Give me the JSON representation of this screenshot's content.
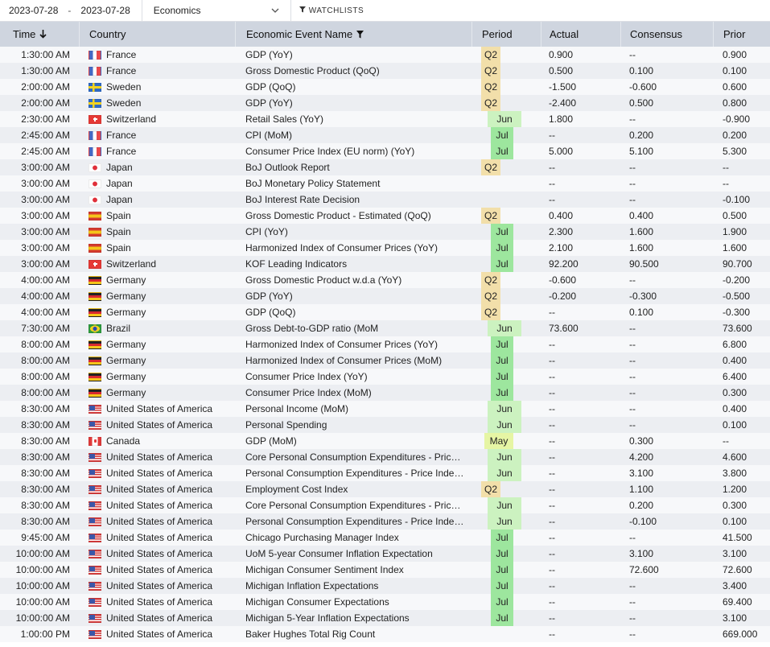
{
  "toolbar": {
    "date_from": "2023-07-28",
    "separator": "-",
    "date_to": "2023-07-28",
    "category": "Economics",
    "watchlists_label": "WATCHLISTS"
  },
  "columns": {
    "time": "Time",
    "country": "Country",
    "event": "Economic Event Name",
    "period": "Period",
    "actual": "Actual",
    "consensus": "Consensus",
    "prior": "Prior"
  },
  "rows": [
    {
      "time": "1:30:00 AM",
      "flag": "fr",
      "country": "France",
      "event": "GDP (YoY)",
      "period": "Q2",
      "actual": "0.900",
      "consensus": "--",
      "prior": "0.900"
    },
    {
      "time": "1:30:00 AM",
      "flag": "fr",
      "country": "France",
      "event": "Gross Domestic Product (QoQ)",
      "period": "Q2",
      "actual": "0.500",
      "consensus": "0.100",
      "prior": "0.100"
    },
    {
      "time": "2:00:00 AM",
      "flag": "se",
      "country": "Sweden",
      "event": "GDP (QoQ)",
      "period": "Q2",
      "actual": "-1.500",
      "consensus": "-0.600",
      "prior": "0.600"
    },
    {
      "time": "2:00:00 AM",
      "flag": "se",
      "country": "Sweden",
      "event": "GDP (YoY)",
      "period": "Q2",
      "actual": "-2.400",
      "consensus": "0.500",
      "prior": "0.800"
    },
    {
      "time": "2:30:00 AM",
      "flag": "ch",
      "country": "Switzerland",
      "event": "Retail Sales (YoY)",
      "period": "Jun",
      "actual": "1.800",
      "consensus": "--",
      "prior": "-0.900"
    },
    {
      "time": "2:45:00 AM",
      "flag": "fr",
      "country": "France",
      "event": "CPI (MoM)",
      "period": "Jul",
      "actual": "--",
      "consensus": "0.200",
      "prior": "0.200"
    },
    {
      "time": "2:45:00 AM",
      "flag": "fr",
      "country": "France",
      "event": "Consumer Price Index (EU norm) (YoY)",
      "period": "Jul",
      "actual": "5.000",
      "consensus": "5.100",
      "prior": "5.300"
    },
    {
      "time": "3:00:00 AM",
      "flag": "jp",
      "country": "Japan",
      "event": "BoJ Outlook Report",
      "period": "Q2",
      "actual": "--",
      "consensus": "--",
      "prior": "--"
    },
    {
      "time": "3:00:00 AM",
      "flag": "jp",
      "country": "Japan",
      "event": "BoJ Monetary Policy Statement",
      "period": "",
      "actual": "--",
      "consensus": "--",
      "prior": "--"
    },
    {
      "time": "3:00:00 AM",
      "flag": "jp",
      "country": "Japan",
      "event": "BoJ Interest Rate Decision",
      "period": "",
      "actual": "--",
      "consensus": "--",
      "prior": "-0.100"
    },
    {
      "time": "3:00:00 AM",
      "flag": "es",
      "country": "Spain",
      "event": "Gross Domestic Product - Estimated (QoQ)",
      "period": "Q2",
      "actual": "0.400",
      "consensus": "0.400",
      "prior": "0.500"
    },
    {
      "time": "3:00:00 AM",
      "flag": "es",
      "country": "Spain",
      "event": "CPI (YoY)",
      "period": "Jul",
      "actual": "2.300",
      "consensus": "1.600",
      "prior": "1.900"
    },
    {
      "time": "3:00:00 AM",
      "flag": "es",
      "country": "Spain",
      "event": "Harmonized Index of Consumer Prices (YoY)",
      "period": "Jul",
      "actual": "2.100",
      "consensus": "1.600",
      "prior": "1.600"
    },
    {
      "time": "3:00:00 AM",
      "flag": "ch",
      "country": "Switzerland",
      "event": "KOF Leading Indicators",
      "period": "Jul",
      "actual": "92.200",
      "consensus": "90.500",
      "prior": "90.700"
    },
    {
      "time": "4:00:00 AM",
      "flag": "de",
      "country": "Germany",
      "event": "Gross Domestic Product w.d.a (YoY)",
      "period": "Q2",
      "actual": "-0.600",
      "consensus": "--",
      "prior": "-0.200"
    },
    {
      "time": "4:00:00 AM",
      "flag": "de",
      "country": "Germany",
      "event": "GDP (YoY)",
      "period": "Q2",
      "actual": "-0.200",
      "consensus": "-0.300",
      "prior": "-0.500"
    },
    {
      "time": "4:00:00 AM",
      "flag": "de",
      "country": "Germany",
      "event": "GDP (QoQ)",
      "period": "Q2",
      "actual": "--",
      "consensus": "0.100",
      "prior": "-0.300"
    },
    {
      "time": "7:30:00 AM",
      "flag": "br",
      "country": "Brazil",
      "event": "Gross Debt-to-GDP ratio (MoM",
      "period": "Jun",
      "actual": "73.600",
      "consensus": "--",
      "prior": "73.600"
    },
    {
      "time": "8:00:00 AM",
      "flag": "de",
      "country": "Germany",
      "event": "Harmonized Index of Consumer Prices (YoY)",
      "period": "Jul",
      "actual": "--",
      "consensus": "--",
      "prior": "6.800"
    },
    {
      "time": "8:00:00 AM",
      "flag": "de",
      "country": "Germany",
      "event": "Harmonized Index of Consumer Prices (MoM)",
      "period": "Jul",
      "actual": "--",
      "consensus": "--",
      "prior": "0.400"
    },
    {
      "time": "8:00:00 AM",
      "flag": "de",
      "country": "Germany",
      "event": "Consumer Price Index (YoY)",
      "period": "Jul",
      "actual": "--",
      "consensus": "--",
      "prior": "6.400"
    },
    {
      "time": "8:00:00 AM",
      "flag": "de",
      "country": "Germany",
      "event": "Consumer Price Index (MoM)",
      "period": "Jul",
      "actual": "--",
      "consensus": "--",
      "prior": "0.300"
    },
    {
      "time": "8:30:00 AM",
      "flag": "us",
      "country": "United States of America",
      "event": "Personal Income (MoM)",
      "period": "Jun",
      "actual": "--",
      "consensus": "--",
      "prior": "0.400"
    },
    {
      "time": "8:30:00 AM",
      "flag": "us",
      "country": "United States of America",
      "event": "Personal Spending",
      "period": "Jun",
      "actual": "--",
      "consensus": "--",
      "prior": "0.100"
    },
    {
      "time": "8:30:00 AM",
      "flag": "ca",
      "country": "Canada",
      "event": "GDP (MoM)",
      "period": "May",
      "actual": "--",
      "consensus": "0.300",
      "prior": "--"
    },
    {
      "time": "8:30:00 AM",
      "flag": "us",
      "country": "United States of America",
      "event": "Core Personal Consumption Expenditures - Price Index (YoY)",
      "period": "Jun",
      "actual": "--",
      "consensus": "4.200",
      "prior": "4.600"
    },
    {
      "time": "8:30:00 AM",
      "flag": "us",
      "country": "United States of America",
      "event": "Personal Consumption Expenditures - Price Index (YoY)",
      "period": "Jun",
      "actual": "--",
      "consensus": "3.100",
      "prior": "3.800"
    },
    {
      "time": "8:30:00 AM",
      "flag": "us",
      "country": "United States of America",
      "event": "Employment Cost Index",
      "period": "Q2",
      "actual": "--",
      "consensus": "1.100",
      "prior": "1.200"
    },
    {
      "time": "8:30:00 AM",
      "flag": "us",
      "country": "United States of America",
      "event": "Core Personal Consumption Expenditures - Price Index (MoM)",
      "period": "Jun",
      "actual": "--",
      "consensus": "0.200",
      "prior": "0.300"
    },
    {
      "time": "8:30:00 AM",
      "flag": "us",
      "country": "United States of America",
      "event": "Personal Consumption Expenditures - Price Index (MoM)",
      "period": "Jun",
      "actual": "--",
      "consensus": "-0.100",
      "prior": "0.100"
    },
    {
      "time": "9:45:00 AM",
      "flag": "us",
      "country": "United States of America",
      "event": "Chicago Purchasing Manager Index",
      "period": "Jul",
      "actual": "--",
      "consensus": "--",
      "prior": "41.500"
    },
    {
      "time": "10:00:00 AM",
      "flag": "us",
      "country": "United States of America",
      "event": "UoM 5-year Consumer Inflation Expectation",
      "period": "Jul",
      "actual": "--",
      "consensus": "3.100",
      "prior": "3.100"
    },
    {
      "time": "10:00:00 AM",
      "flag": "us",
      "country": "United States of America",
      "event": "Michigan Consumer Sentiment Index",
      "period": "Jul",
      "actual": "--",
      "consensus": "72.600",
      "prior": "72.600"
    },
    {
      "time": "10:00:00 AM",
      "flag": "us",
      "country": "United States of America",
      "event": "Michigan Inflation Expectations",
      "period": "Jul",
      "actual": "--",
      "consensus": "--",
      "prior": "3.400"
    },
    {
      "time": "10:00:00 AM",
      "flag": "us",
      "country": "United States of America",
      "event": "Michigan Consumer Expectations",
      "period": "Jul",
      "actual": "--",
      "consensus": "--",
      "prior": "69.400"
    },
    {
      "time": "10:00:00 AM",
      "flag": "us",
      "country": "United States of America",
      "event": "Michigan 5-Year Inflation Expectations",
      "period": "Jul",
      "actual": "--",
      "consensus": "--",
      "prior": "3.100"
    },
    {
      "time": "1:00:00 PM",
      "flag": "us",
      "country": "United States of America",
      "event": "Baker Hughes Total Rig Count",
      "period": "",
      "actual": "--",
      "consensus": "--",
      "prior": "669.000"
    }
  ],
  "period_colors": {
    "Q2": "#f2dfaa",
    "Jun": "#ccf2c0",
    "Jul": "#9de69e",
    "May": "#e6f5a4"
  }
}
